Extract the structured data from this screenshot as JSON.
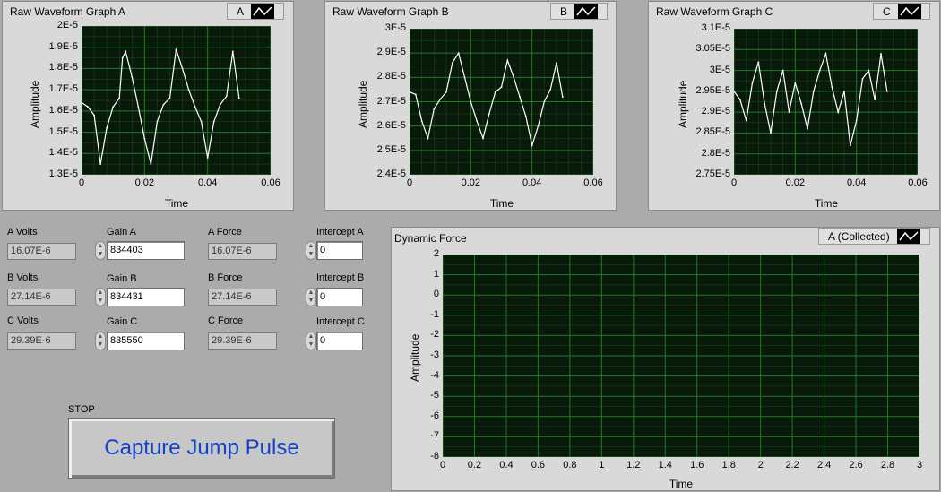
{
  "graphs": {
    "a": {
      "title": "Raw Waveform Graph A",
      "legend": "A",
      "xlabel": "Time",
      "ylabel": "Amplitude",
      "yticks": [
        "2E-5",
        "1.9E-5",
        "1.8E-5",
        "1.7E-5",
        "1.6E-5",
        "1.5E-5",
        "1.4E-5",
        "1.3E-5"
      ],
      "xticks": [
        "0",
        "0.02",
        "0.04",
        "0.06"
      ]
    },
    "b": {
      "title": "Raw Waveform Graph B",
      "legend": "B",
      "xlabel": "Time",
      "ylabel": "Amplitude",
      "yticks": [
        "3E-5",
        "2.9E-5",
        "2.8E-5",
        "2.7E-5",
        "2.6E-5",
        "2.5E-5",
        "2.4E-5"
      ],
      "xticks": [
        "0",
        "0.02",
        "0.04",
        "0.06"
      ]
    },
    "c": {
      "title": "Raw Waveform Graph C",
      "legend": "C",
      "xlabel": "Time",
      "ylabel": "Amplitude",
      "yticks": [
        "3.1E-5",
        "3.05E-5",
        "3E-5",
        "2.95E-5",
        "2.9E-5",
        "2.85E-5",
        "2.8E-5",
        "2.75E-5"
      ],
      "xticks": [
        "0",
        "0.02",
        "0.04",
        "0.06"
      ]
    },
    "d": {
      "title": "Dynamic Force",
      "legend": "A (Collected)",
      "xlabel": "Time",
      "ylabel": "Amplitude",
      "yticks": [
        "2",
        "1",
        "0",
        "-1",
        "-2",
        "-3",
        "-4",
        "-5",
        "-6",
        "-7",
        "-8"
      ],
      "xticks": [
        "0",
        "0.2",
        "0.4",
        "0.6",
        "0.8",
        "1",
        "1.2",
        "1.4",
        "1.6",
        "1.8",
        "2",
        "2.2",
        "2.4",
        "2.6",
        "2.8",
        "3"
      ]
    }
  },
  "controls": {
    "a_volts_label": "A Volts",
    "a_volts": "16.07E-6",
    "b_volts_label": "B Volts",
    "b_volts": "27.14E-6",
    "c_volts_label": "C Volts",
    "c_volts": "29.39E-6",
    "gain_a_label": "Gain A",
    "gain_a": "834403",
    "gain_b_label": "Gain B",
    "gain_b": "834431",
    "gain_c_label": "Gain C",
    "gain_c": "835550",
    "a_force_label": "A Force",
    "a_force": "16.07E-6",
    "b_force_label": "B Force",
    "b_force": "27.14E-6",
    "c_force_label": "C Force",
    "c_force": "29.39E-6",
    "intercept_a_label": "Intercept A",
    "intercept_a": "0",
    "intercept_b_label": "Intercept B",
    "intercept_b": "0",
    "intercept_c_label": "Intercept C",
    "intercept_c": "0"
  },
  "stop": {
    "label": "STOP",
    "button_text": "Capture Jump Pulse"
  },
  "colors": {
    "plot_bg": "#0a1a0a",
    "grid": "#1f7a2a",
    "trace": "#ffffff",
    "button_text": "#1540c8"
  },
  "chart_data": [
    {
      "type": "line",
      "title": "Raw Waveform Graph A",
      "xlabel": "Time",
      "ylabel": "Amplitude",
      "xlim": [
        0,
        0.06
      ],
      "ylim": [
        1.3e-05,
        2e-05
      ],
      "grid": true,
      "series": [
        {
          "x": [
            0,
            0.002,
            0.004,
            0.006,
            0.008,
            0.01,
            0.012,
            0.013,
            0.014,
            0.016,
            0.018,
            0.02,
            0.022,
            0.024,
            0.026,
            0.028,
            0.03,
            0.032,
            0.034,
            0.036,
            0.038,
            0.04,
            0.042,
            0.044,
            0.046,
            0.048,
            0.05
          ],
          "values": [
            1.64e-05,
            1.62e-05,
            1.58e-05,
            1.35e-05,
            1.52e-05,
            1.62e-05,
            1.66e-05,
            1.85e-05,
            1.88e-05,
            1.76e-05,
            1.62e-05,
            1.47e-05,
            1.35e-05,
            1.55e-05,
            1.63e-05,
            1.66e-05,
            1.89e-05,
            1.8e-05,
            1.7e-05,
            1.62e-05,
            1.55e-05,
            1.38e-05,
            1.55e-05,
            1.63e-05,
            1.67e-05,
            1.88e-05,
            1.66e-05
          ]
        }
      ]
    },
    {
      "type": "line",
      "title": "Raw Waveform Graph B",
      "xlabel": "Time",
      "ylabel": "Amplitude",
      "xlim": [
        0,
        0.06
      ],
      "ylim": [
        2.4e-05,
        3e-05
      ],
      "grid": true,
      "series": [
        {
          "x": [
            0,
            0.002,
            0.004,
            0.006,
            0.008,
            0.01,
            0.012,
            0.014,
            0.016,
            0.018,
            0.02,
            0.022,
            0.024,
            0.026,
            0.028,
            0.03,
            0.032,
            0.034,
            0.036,
            0.038,
            0.04,
            0.042,
            0.044,
            0.046,
            0.048,
            0.05
          ],
          "values": [
            2.74e-05,
            2.73e-05,
            2.62e-05,
            2.55e-05,
            2.67e-05,
            2.71e-05,
            2.74e-05,
            2.86e-05,
            2.9e-05,
            2.8e-05,
            2.7e-05,
            2.62e-05,
            2.55e-05,
            2.65e-05,
            2.74e-05,
            2.76e-05,
            2.87e-05,
            2.8e-05,
            2.72e-05,
            2.64e-05,
            2.52e-05,
            2.6e-05,
            2.7e-05,
            2.75e-05,
            2.86e-05,
            2.72e-05
          ]
        }
      ]
    },
    {
      "type": "line",
      "title": "Raw Waveform Graph C",
      "xlabel": "Time",
      "ylabel": "Amplitude",
      "xlim": [
        0,
        0.06
      ],
      "ylim": [
        2.75e-05,
        3.1e-05
      ],
      "grid": true,
      "series": [
        {
          "x": [
            0,
            0.002,
            0.004,
            0.006,
            0.008,
            0.01,
            0.012,
            0.014,
            0.016,
            0.018,
            0.02,
            0.022,
            0.024,
            0.026,
            0.028,
            0.03,
            0.032,
            0.034,
            0.036,
            0.038,
            0.04,
            0.042,
            0.044,
            0.046,
            0.048,
            0.05
          ],
          "values": [
            2.95e-05,
            2.93e-05,
            2.88e-05,
            2.97e-05,
            3.02e-05,
            2.92e-05,
            2.85e-05,
            2.95e-05,
            3e-05,
            2.9e-05,
            2.97e-05,
            2.92e-05,
            2.86e-05,
            2.95e-05,
            3e-05,
            3.04e-05,
            2.96e-05,
            2.9e-05,
            2.95e-05,
            2.82e-05,
            2.88e-05,
            2.98e-05,
            3e-05,
            2.93e-05,
            3.04e-05,
            2.95e-05
          ]
        }
      ]
    },
    {
      "type": "line",
      "title": "Dynamic Force",
      "xlabel": "Time",
      "ylabel": "Amplitude",
      "xlim": [
        0,
        3
      ],
      "ylim": [
        -8,
        2
      ],
      "grid": true,
      "series": []
    }
  ]
}
